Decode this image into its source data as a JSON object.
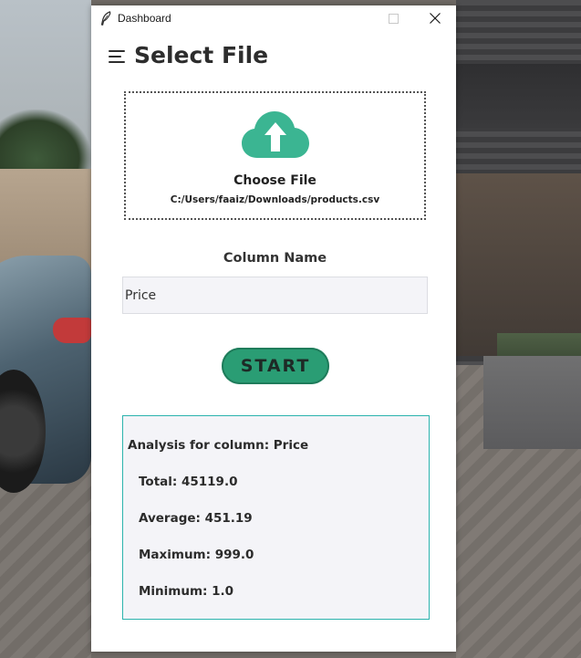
{
  "window": {
    "title": "Dashboard"
  },
  "header": {
    "title": "Select File",
    "menu_icon": "hamburger-menu-icon"
  },
  "dropzone": {
    "icon": "cloud-upload-icon",
    "label": "Choose File",
    "file_path": "C:/Users/faaiz/Downloads/products.csv"
  },
  "column": {
    "label": "Column Name",
    "value": "Price"
  },
  "start_button": {
    "label": "START"
  },
  "results": {
    "heading": "Analysis for column: Price",
    "total": "Total: 45119.0",
    "average": "Average: 451.19",
    "maximum": "Maximum: 999.0",
    "minimum": "Minimum: 1.0"
  },
  "colors": {
    "accent": "#2a9d74",
    "cloud": "#3bb592",
    "results_border": "#2cb3ad",
    "input_background": "#f4f4f8"
  }
}
